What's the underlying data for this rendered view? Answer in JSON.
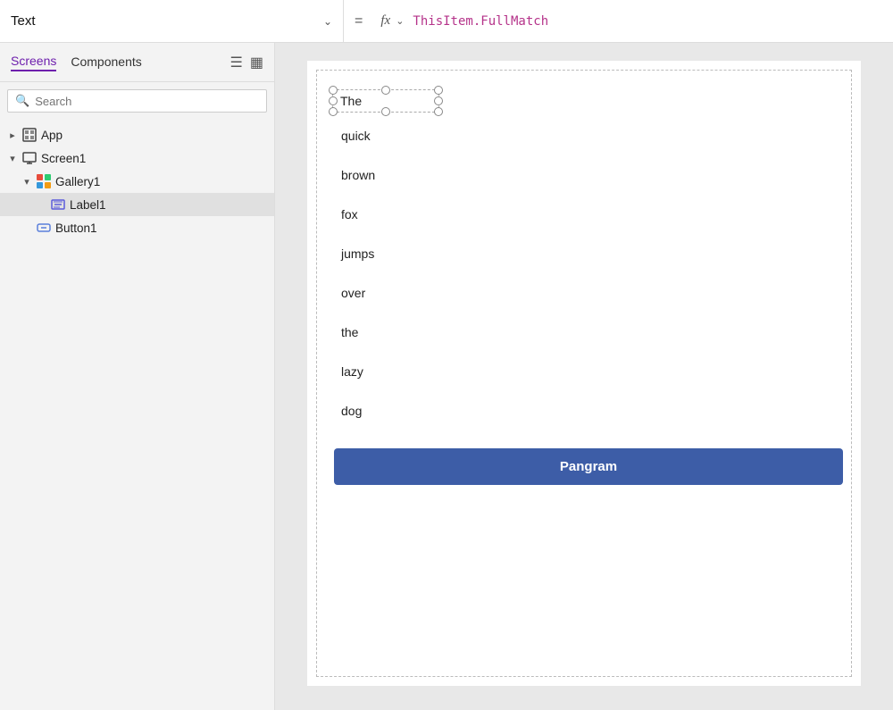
{
  "topbar": {
    "property_label": "Text",
    "equals": "=",
    "fx_label": "fx",
    "formula": "ThisItem.FullMatch"
  },
  "sidebar": {
    "tab_screens": "Screens",
    "tab_components": "Components",
    "search_placeholder": "Search",
    "tree": [
      {
        "id": "app",
        "label": "App",
        "indent": 1,
        "icon": "app",
        "expandable": true,
        "expanded": false
      },
      {
        "id": "screen1",
        "label": "Screen1",
        "indent": 1,
        "icon": "screen",
        "expandable": true,
        "expanded": true
      },
      {
        "id": "gallery1",
        "label": "Gallery1",
        "indent": 2,
        "icon": "gallery",
        "expandable": true,
        "expanded": true
      },
      {
        "id": "label1",
        "label": "Label1",
        "indent": 3,
        "icon": "label",
        "expandable": false,
        "selected": true
      },
      {
        "id": "button1",
        "label": "Button1",
        "indent": 2,
        "icon": "button",
        "expandable": false
      }
    ]
  },
  "canvas": {
    "first_item": "The",
    "words": [
      "quick",
      "brown",
      "fox",
      "jumps",
      "over",
      "the",
      "lazy",
      "dog"
    ],
    "button_label": "Pangram"
  }
}
